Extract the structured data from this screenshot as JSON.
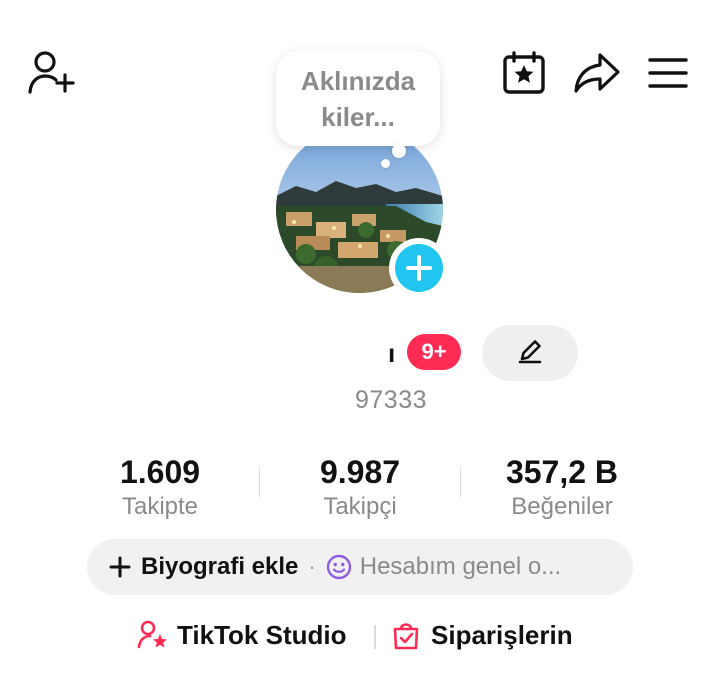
{
  "topbar": {
    "icons": [
      "add-friend-icon",
      "calendar-star-icon",
      "share-icon",
      "menu-icon"
    ]
  },
  "note": {
    "placeholder_line1": "Aklınızda",
    "placeholder_line2": "kiler..."
  },
  "profile": {
    "name_visible_fragment": "ı",
    "notification_badge": "9+",
    "username_visible": "97333"
  },
  "stats": [
    {
      "value": "1.609",
      "label": "Takipte"
    },
    {
      "value": "9.987",
      "label": "Takipçi"
    },
    {
      "value": "357,2 B",
      "label": "Beğeniler"
    }
  ],
  "bio": {
    "add_label": "Biyografi ekle",
    "separator": "·",
    "status_text": "Hesabım genel o..."
  },
  "links": {
    "studio_label": "TikTok Studio",
    "orders_label": "Siparişlerin"
  },
  "colors": {
    "accent_pink": "#fe2c55",
    "accent_cyan": "#20c5f0",
    "status_purple": "#8f5ee0"
  }
}
